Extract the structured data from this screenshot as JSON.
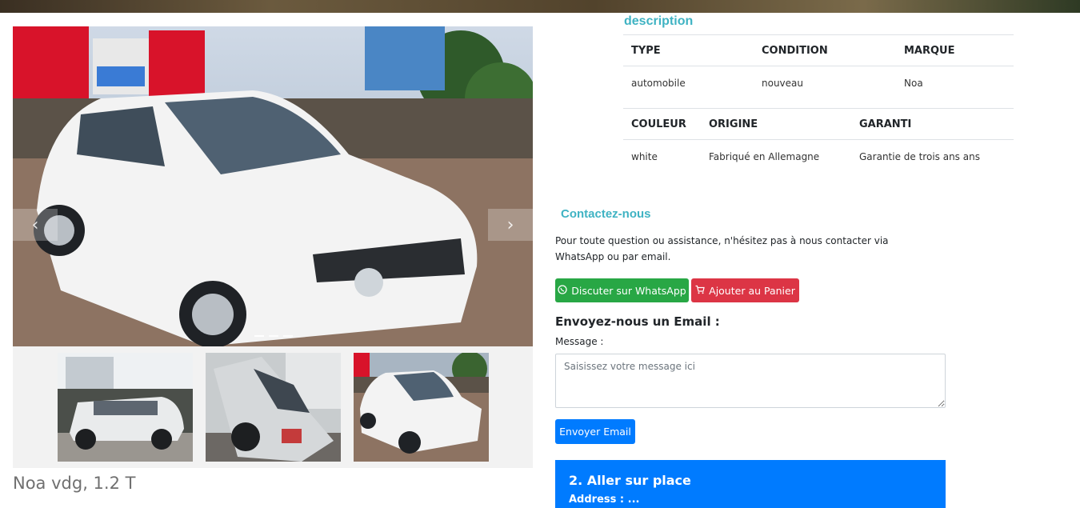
{
  "gallery": {
    "prev_icon": "‹",
    "next_icon": "›",
    "thumbnails": [
      {
        "alt": "silver-van-side-view"
      },
      {
        "alt": "silver-van-tilted-view"
      },
      {
        "alt": "white-suv-front-view"
      }
    ]
  },
  "product": {
    "title": "Noa vdg, 1.2 T"
  },
  "description": {
    "heading": "description",
    "table1": {
      "headers": [
        "TYPE",
        "CONDITION",
        "MARQUE"
      ],
      "values": [
        "automobile",
        "nouveau",
        "Noa"
      ]
    },
    "table2": {
      "headers": [
        "COULEUR",
        "ORIGINE",
        "GARANTI"
      ],
      "values": [
        "white",
        "Fabriqué en Allemagne",
        "Garantie de trois ans ans"
      ]
    }
  },
  "contact": {
    "heading": "Contactez-nous",
    "text": "Pour toute question ou assistance, n'hésitez pas à nous contacter via WhatsApp ou par email.",
    "whatsapp_label": "Discuter sur WhatsApp",
    "cart_label": "Ajouter au Panier",
    "email_heading": "Envoyez-nous un Email :",
    "message_label": "Message :",
    "message_placeholder": "Saisissez votre message ici",
    "send_label": "Envoyer Email"
  },
  "visit": {
    "title": "2. Aller sur place",
    "subtitle": "Address : ..."
  },
  "colors": {
    "accent_teal": "#3fb3c3",
    "whatsapp_green": "#28a745",
    "cart_red": "#dc3545",
    "primary_blue": "#007bff"
  }
}
